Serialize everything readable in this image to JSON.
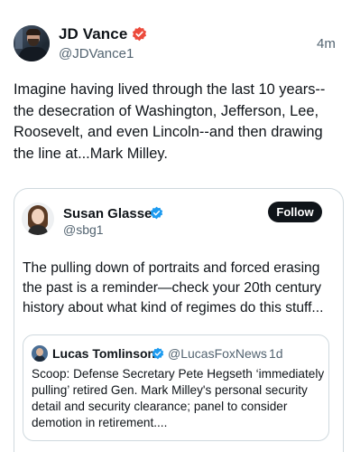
{
  "post": {
    "author_name": "JD Vance",
    "author_handle": "@JDVance1",
    "timestamp": "4m",
    "text": "Imagine having lived through the last 10 years--the desecration of Washington, Jefferson, Lee, Roosevelt, and even Lincoln--and then drawing the line at...Mark Milley.",
    "verified_icon": "verified-badge-icon",
    "verified_color": "#ec4b3c"
  },
  "quoted_post": {
    "author_name": "Susan Glasser",
    "author_handle": "@sbg1",
    "follow_label": "Follow",
    "text": "The pulling down of portraits and forced erasing the past is a reminder—check your 20th century history about what kind of regimes do this stuff...",
    "verified_icon": "verified-badge-icon",
    "verified_color": "#1d9bf0"
  },
  "nested_quote": {
    "author_name": "Lucas Tomlinson",
    "author_handle": "@LucasFoxNews",
    "separator": "·",
    "timestamp": "1d",
    "text": "Scoop: Defense Secretary Pete Hegseth ‘immediately pulling’ retired Gen. Mark Milley's personal security detail and security clearance; panel to consider demotion in retirement....",
    "verified_icon": "verified-badge-icon",
    "verified_color": "#1d9bf0"
  }
}
